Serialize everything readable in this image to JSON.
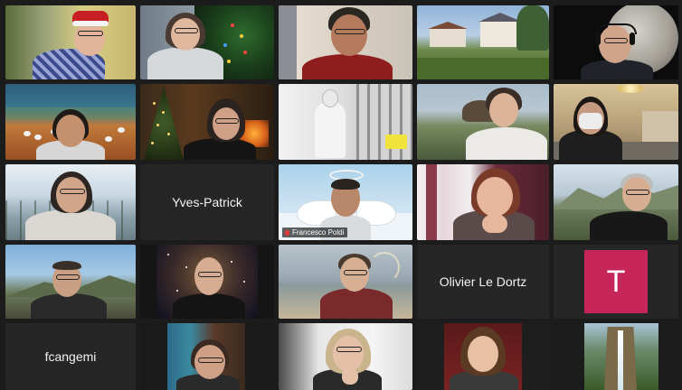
{
  "meeting": {
    "grid": "5 columns x 5 rows gallery view",
    "active_speaker": "Francesco Poldi"
  },
  "tiles": {
    "r1c1": {
      "name": ""
    },
    "r1c2": {
      "name": ""
    },
    "r1c3": {
      "name": ""
    },
    "r1c4": {
      "name": ""
    },
    "r1c5": {
      "name": ""
    },
    "r2c1": {
      "name": ""
    },
    "r2c2": {
      "name": ""
    },
    "r2c3": {
      "name": ""
    },
    "r2c4": {
      "name": ""
    },
    "r2c5": {
      "name": ""
    },
    "r3c1": {
      "name": ""
    },
    "r3c2": {
      "name": "Yves-Patrick"
    },
    "r3c3": {
      "name": "Francesco Poldi"
    },
    "r3c4": {
      "name": ""
    },
    "r3c5": {
      "name": ""
    },
    "r4c1": {
      "name": ""
    },
    "r4c2": {
      "name": ""
    },
    "r4c3": {
      "name": ""
    },
    "r4c4": {
      "name": "Olivier Le Dortz"
    },
    "r4c5": {
      "name": "",
      "avatar_letter": "T"
    },
    "r5c1": {
      "name": "fcangemi"
    },
    "r5c2": {
      "name": ""
    },
    "r5c3": {
      "name": ""
    },
    "r5c4": {
      "name": ""
    },
    "r5c5": {
      "name": ""
    }
  },
  "colors": {
    "active_border": "#9ad32f",
    "avatar_bg": "#c7265a",
    "tile_bg": "#262626"
  }
}
